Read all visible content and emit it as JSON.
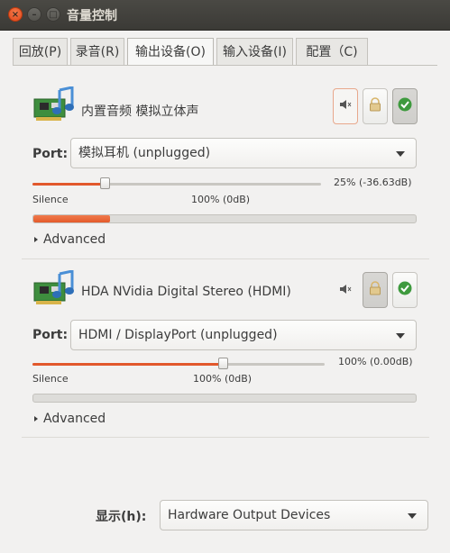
{
  "window": {
    "title": "音量控制",
    "controls": {
      "close": "×",
      "minimize": "–",
      "maximize": "□"
    }
  },
  "tabs": [
    {
      "label": "回放(P)",
      "active": false
    },
    {
      "label": "录音(R)",
      "active": false
    },
    {
      "label": "输出设备(O)",
      "active": true
    },
    {
      "label": "输入设备(I)",
      "active": false
    },
    {
      "label": "配置（C)",
      "active": false
    }
  ],
  "devices": [
    {
      "name": "内置音频 模拟立体声",
      "icon": "sound-card-icon",
      "muted_toggle": true,
      "lock_pressed": false,
      "default_set": true,
      "port_label": "Port:",
      "port_value": "模拟耳机 (unplugged)",
      "volume_fraction": 0.25,
      "volume_text": "25% (-36.63dB)",
      "silence_label": "Silence",
      "ref_label": "100% (0dB)",
      "meter_fraction": 0.2,
      "advanced_label": "Advanced"
    },
    {
      "name": "HDA NVidia Digital Stereo (HDMI)",
      "icon": "sound-card-icon",
      "muted_toggle": false,
      "lock_pressed": true,
      "default_set": true,
      "port_label": "Port:",
      "port_value": "HDMI / DisplayPort (unplugged)",
      "volume_fraction": 0.65,
      "volume_text": "100% (0.00dB)",
      "silence_label": "Silence",
      "ref_label": "100% (0dB)",
      "meter_fraction": 0.0,
      "advanced_label": "Advanced"
    }
  ],
  "footer": {
    "label": "显示(h):",
    "value": "Hardware Output Devices"
  },
  "colors": {
    "accent": "#e2582c",
    "titlebar": "#3d3c38",
    "background": "#f2f1f0"
  }
}
